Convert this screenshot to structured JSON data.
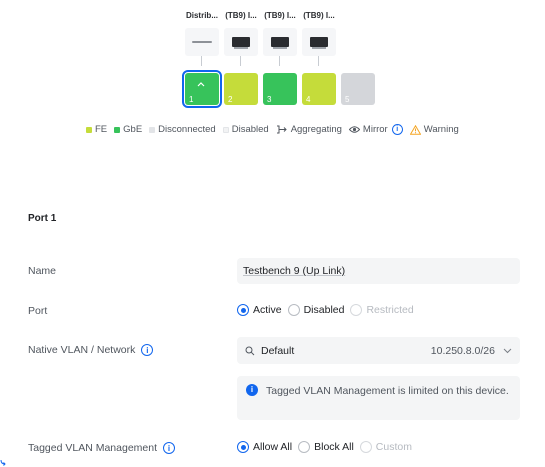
{
  "devices": [
    {
      "label": "Distrib...",
      "kind": "flat"
    },
    {
      "label": "(TB9) I...",
      "kind": "dark"
    },
    {
      "label": "(TB9) I...",
      "kind": "dark"
    },
    {
      "label": "(TB9) I...",
      "kind": "dark"
    }
  ],
  "ports": [
    {
      "number": "1",
      "status": "gbe",
      "selected": true
    },
    {
      "number": "2",
      "status": "fe"
    },
    {
      "number": "3",
      "status": "gbe"
    },
    {
      "number": "4",
      "status": "fe"
    },
    {
      "number": "5",
      "status": "disconnected"
    }
  ],
  "legend": {
    "fe": "FE",
    "gbe": "GbE",
    "disconnected": "Disconnected",
    "disabled": "Disabled",
    "aggregating": "Aggregating",
    "mirror": "Mirror",
    "warning": "Warning"
  },
  "colors": {
    "fe": "#c5dc3a",
    "gbe": "#37c35b",
    "disconnected": "#d4d6da",
    "accent": "#1166ee",
    "warning": "#f5a623"
  },
  "form": {
    "title": "Port 1",
    "name": {
      "label": "Name",
      "value": "Testbench 9 (Up Link)"
    },
    "port": {
      "label": "Port",
      "options": [
        "Active",
        "Disabled",
        "Restricted"
      ],
      "selected": "Active"
    },
    "native_vlan": {
      "label": "Native VLAN / Network",
      "value": "Default",
      "subnet": "10.250.8.0/26",
      "icon": "search-icon"
    },
    "notice": "Tagged VLAN Management is limited on this device.",
    "tagged_vlan": {
      "label": "Tagged VLAN Management",
      "options": [
        "Allow All",
        "Block All",
        "Custom"
      ],
      "selected": "Allow All"
    }
  }
}
